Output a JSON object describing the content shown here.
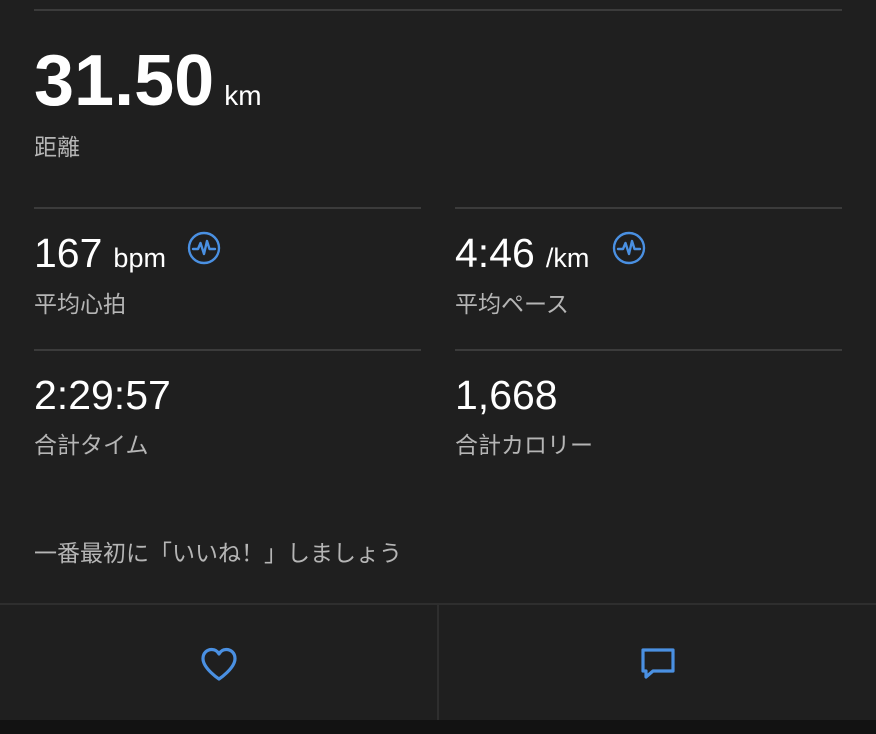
{
  "distance": {
    "value": "31.50",
    "unit": "km",
    "label": "距離"
  },
  "stats": {
    "avg_heart_rate": {
      "value": "167",
      "unit": "bpm",
      "label": "平均心拍",
      "icon": "heart-rate-wave-icon"
    },
    "avg_pace": {
      "value": "4:46",
      "unit": "/km",
      "label": "平均ペース",
      "icon": "heart-rate-wave-icon"
    },
    "total_time": {
      "value": "2:29:57",
      "label": "合計タイム"
    },
    "total_calories": {
      "value": "1,668",
      "label": "合計カロリー"
    }
  },
  "like_prompt": "一番最初に「いいね！」しましょう",
  "actions": {
    "like_icon": "heart-icon",
    "comment_icon": "comment-icon"
  },
  "colors": {
    "background": "#1f1f1f",
    "accent": "#4a90e2",
    "divider": "#3b3b3b",
    "label": "#b5b5b5"
  }
}
